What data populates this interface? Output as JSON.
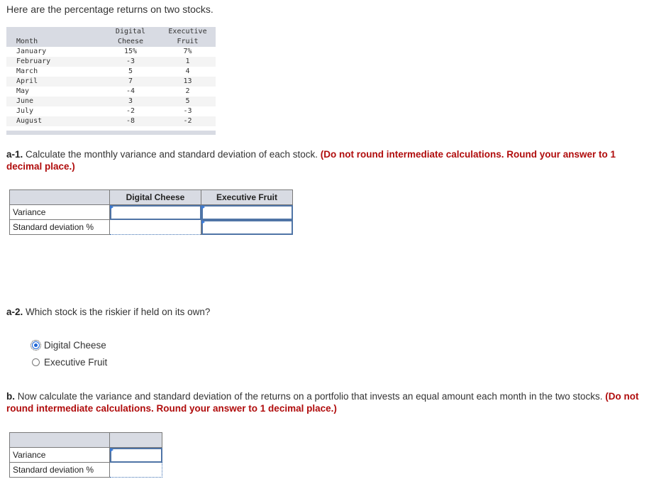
{
  "intro": "Here are the percentage returns on two stocks.",
  "returns_table": {
    "headers": {
      "month": "Month",
      "col1_line1": "Digital",
      "col1_line2": "Cheese",
      "col2_line1": "Executive",
      "col2_line2": "Fruit"
    },
    "rows": [
      {
        "month": "January",
        "digital_cheese": "15%",
        "executive_fruit": "7%"
      },
      {
        "month": "February",
        "digital_cheese": "-3",
        "executive_fruit": "1"
      },
      {
        "month": "March",
        "digital_cheese": "5",
        "executive_fruit": "4"
      },
      {
        "month": "April",
        "digital_cheese": "7",
        "executive_fruit": "13"
      },
      {
        "month": "May",
        "digital_cheese": "-4",
        "executive_fruit": "2"
      },
      {
        "month": "June",
        "digital_cheese": "3",
        "executive_fruit": "5"
      },
      {
        "month": "July",
        "digital_cheese": "-2",
        "executive_fruit": "-3"
      },
      {
        "month": "August",
        "digital_cheese": "-8",
        "executive_fruit": "-2"
      }
    ]
  },
  "part_a1": {
    "label": "a-1.",
    "text": " Calculate the monthly variance and standard deviation of each stock. ",
    "instruction": "(Do not round intermediate calculations. Round your answer to 1 decimal place.)",
    "table": {
      "col_headers": [
        "Digital Cheese",
        "Executive Fruit"
      ],
      "rows": [
        {
          "label": "Variance",
          "values": [
            "",
            ""
          ]
        },
        {
          "label": "Standard deviation %",
          "values": [
            "",
            ""
          ]
        }
      ]
    }
  },
  "part_a2": {
    "label": "a-2.",
    "text": " Which stock is the riskier if held on its own?",
    "options": [
      {
        "label": "Digital Cheese",
        "selected": true
      },
      {
        "label": "Executive Fruit",
        "selected": false
      }
    ]
  },
  "part_b": {
    "label": "b.",
    "text": " Now calculate the variance and standard deviation of the  returns on a portfolio that invests an equal amount each month in the two stocks. ",
    "instruction": "(Do not round intermediate calculations. Round your answer to 1 decimal place.)",
    "table": {
      "rows": [
        {
          "label": "Variance",
          "value": ""
        },
        {
          "label": "Standard deviation %",
          "value": ""
        }
      ]
    }
  }
}
